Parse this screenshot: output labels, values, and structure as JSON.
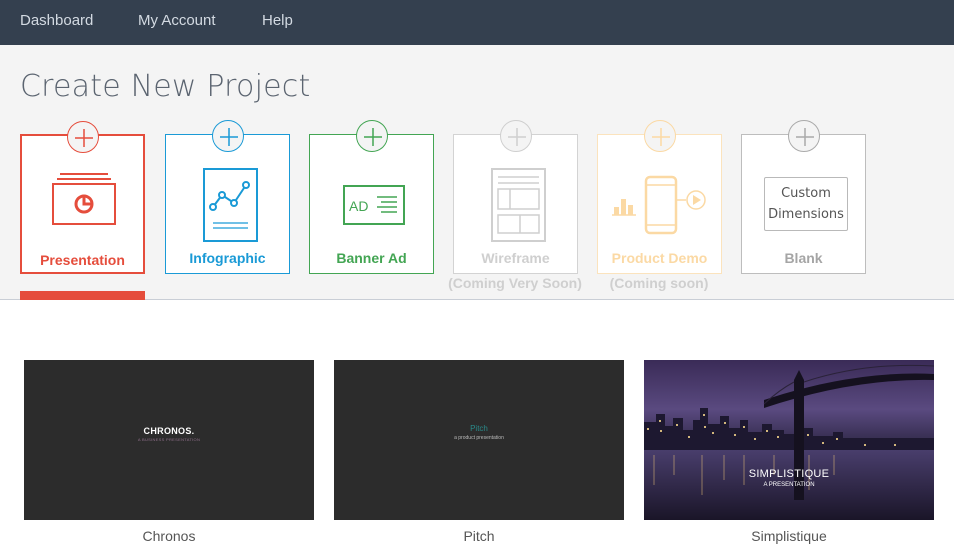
{
  "nav": {
    "items": [
      "Dashboard",
      "My Account",
      "Help"
    ]
  },
  "page_title": "Create New Project",
  "project_types": [
    {
      "label": "Presentation",
      "color": "#e54d3c",
      "icon": "presentation-icon",
      "active": true
    },
    {
      "label": "Infographic",
      "color": "#1a9ad6",
      "icon": "infographic-icon"
    },
    {
      "label": "Banner Ad",
      "color": "#43a553",
      "icon": "banner-ad-icon"
    },
    {
      "label": "Wireframe",
      "sublabel": "(Coming Very Soon)",
      "color": "#cfcfcf",
      "icon": "wireframe-icon"
    },
    {
      "label": "Product Demo",
      "sublabel": "(Coming soon)",
      "color": "#fbd9a4",
      "icon": "product-demo-icon"
    },
    {
      "label": "Blank",
      "color": "#aaaaaa",
      "icon": "blank-icon",
      "custom_text": "Custom Dimensions"
    }
  ],
  "banner_icon_text": "AD",
  "templates": [
    {
      "name": "Chronos",
      "title": "CHRONOS.",
      "subtitle": "A BUSINESS PRESENTATION"
    },
    {
      "name": "Pitch",
      "title": "Pitch",
      "subtitle": "a product presentation"
    },
    {
      "name": "Simplistique",
      "title": "SIMPLISTIQUE",
      "subtitle": "A PRESENTATION"
    }
  ]
}
